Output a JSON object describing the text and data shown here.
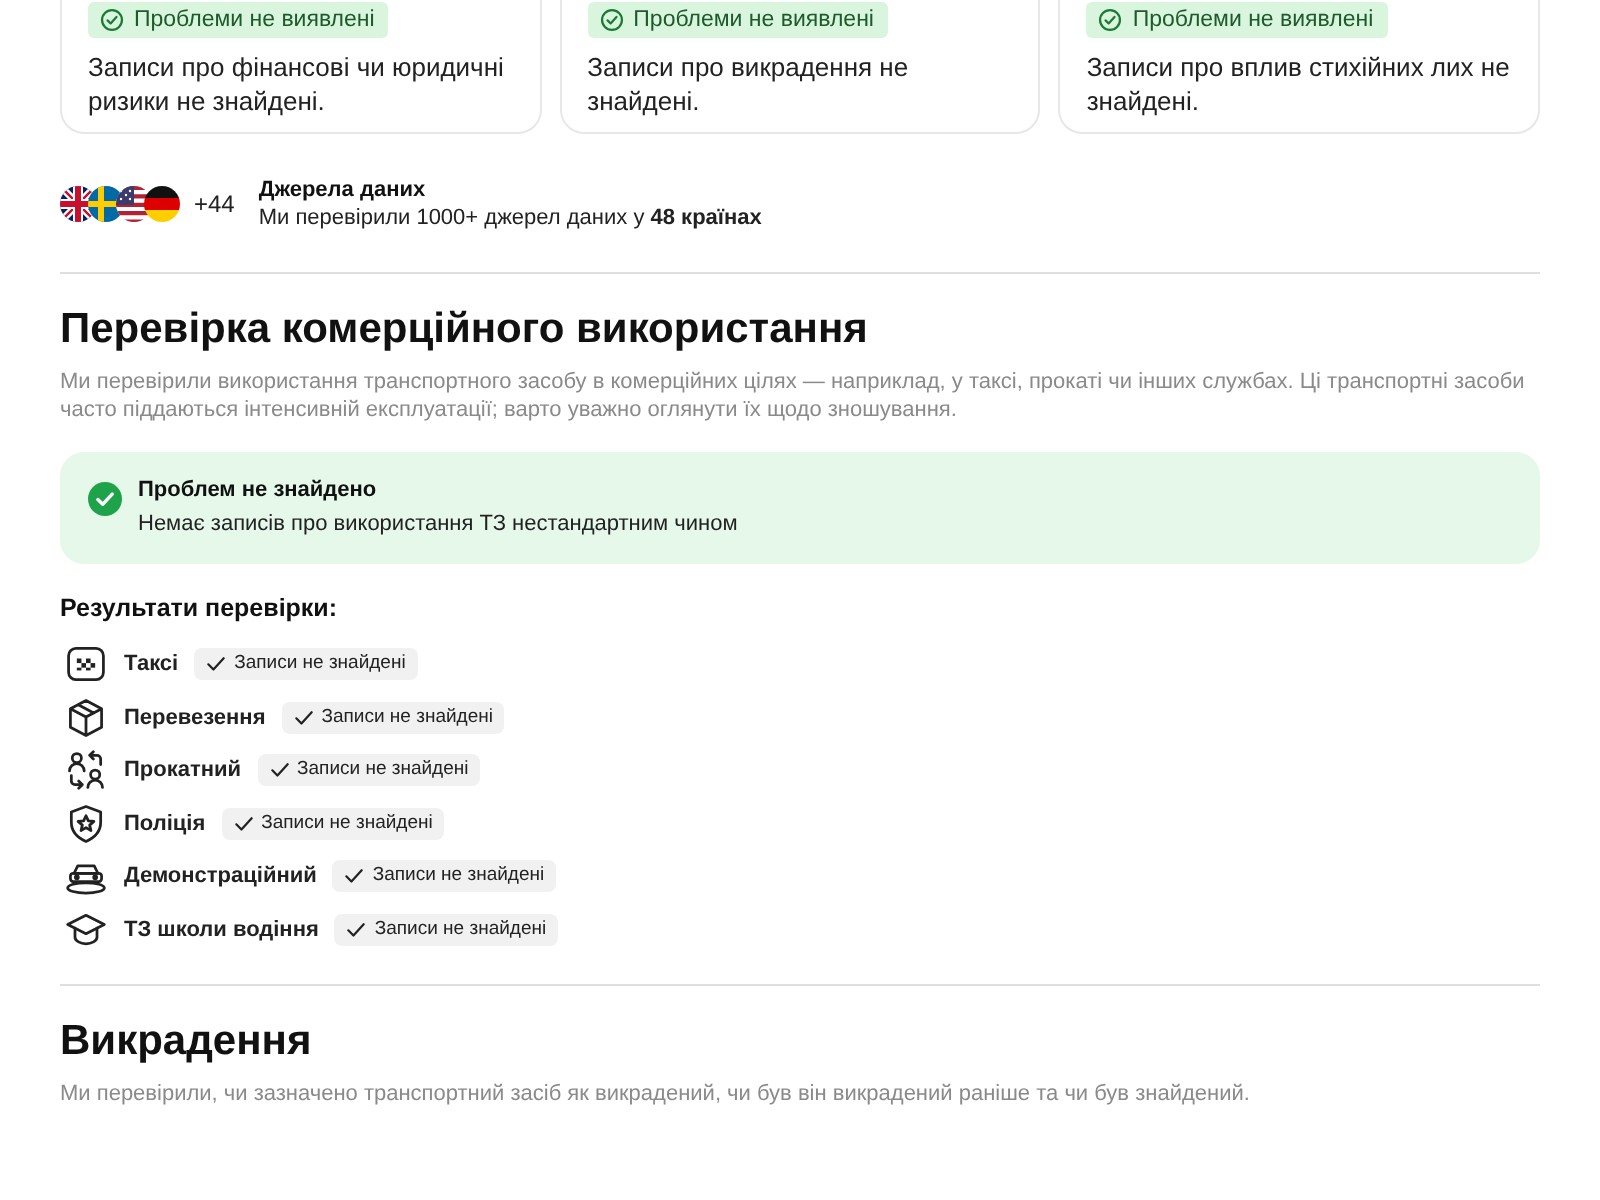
{
  "top_cards": [
    {
      "badge": "Проблеми не виявлені",
      "text": "Записи про фінансові чи юридичні ризики не знайдені."
    },
    {
      "badge": "Проблеми не виявлені",
      "text": "Записи про викрадення не знайдені."
    },
    {
      "badge": "Проблеми не виявлені",
      "text": "Записи про вплив стихійних лих не знайдені."
    }
  ],
  "data_sources": {
    "extra_count": "+44",
    "title": "Джерела даних",
    "text": "Ми перевірили 1000+ джерел даних у **48 країнах**"
  },
  "commercial_use": {
    "title": "Перевірка комерційного використання",
    "description": "Ми перевірили використання транспортного засобу в комерційних цілях — наприклад, у таксі, прокаті чи інших службах. Ці транспортні засоби часто піддаються інтенсивній експлуатації; варто уважно оглянути їх щодо зношування.",
    "status": {
      "title": "Проблем не знайдено",
      "text": "Немає записів про використання ТЗ нестандартним чином"
    },
    "results_title": "Результати перевірки:",
    "results": [
      {
        "kind": "taxi",
        "label": "Таксі",
        "status": "Записи не знайдені"
      },
      {
        "kind": "cargo",
        "label": "Перевезення",
        "status": "Записи не знайдені"
      },
      {
        "kind": "rental",
        "label": "Прокатний",
        "status": "Записи не знайдені"
      },
      {
        "kind": "police",
        "label": "Поліція",
        "status": "Записи не знайдені"
      },
      {
        "kind": "demo",
        "label": "Демонстраційний",
        "status": "Записи не знайдені"
      },
      {
        "kind": "school",
        "label": "ТЗ школи водіння",
        "status": "Записи не знайдені"
      }
    ]
  },
  "theft": {
    "title": "Викрадення",
    "description": "Ми перевірили, чи зазначено транспортний засіб як викрадений, чи був він викрадений раніше та чи був знайдений."
  }
}
